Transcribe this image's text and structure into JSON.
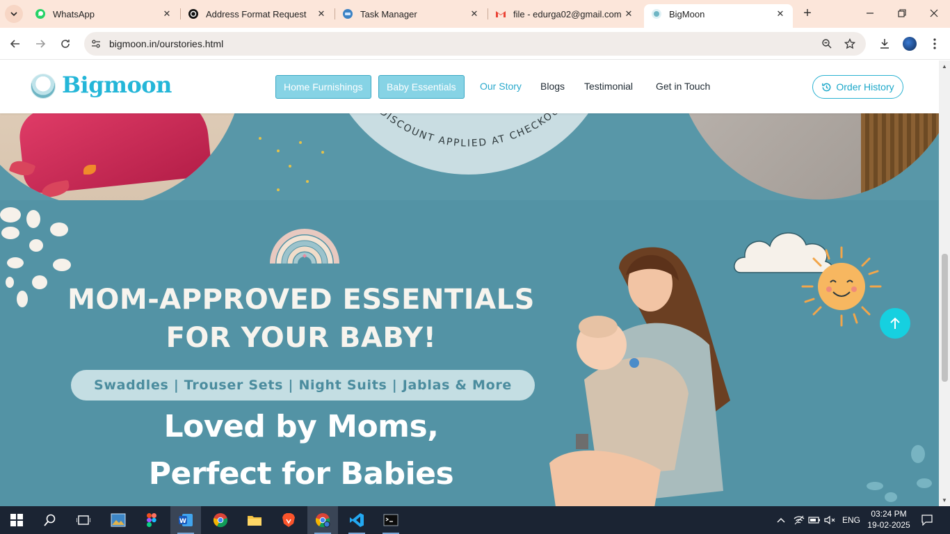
{
  "browser": {
    "tabs": [
      {
        "title": "WhatsApp",
        "icon": "whatsapp-icon",
        "active": false
      },
      {
        "title": "Address Format Request",
        "icon": "openai-icon",
        "active": false
      },
      {
        "title": "Task Manager",
        "icon": "task-manager-icon",
        "active": false
      },
      {
        "title": "file - edurga02@gmail.com",
        "icon": "gmail-icon",
        "active": false
      },
      {
        "title": "BigMoon",
        "icon": "bigmoon-favicon",
        "active": true
      }
    ],
    "url": "bigmoon.in/ourstories.html"
  },
  "site": {
    "logo_text": "Bigmoon",
    "nav": {
      "home_furnishings": "Home Furnishings",
      "baby_essentials": "Baby Essentials",
      "our_story": "Our Story",
      "blogs": "Blogs",
      "testimonial": "Testimonial",
      "get_in_touch": "Get in Touch"
    },
    "order_history": "Order History",
    "accent_color": "#2aa9cc"
  },
  "hero": {
    "discount_text": "• DISCOUNT APPLIED AT CHECKOUT"
  },
  "banner": {
    "headline_line1": "MOM-APPROVED ESSENTIALS",
    "headline_line2": "FOR YOUR BABY!",
    "categories": "Swaddles | Trouser Sets | Night Suits | Jablas & More",
    "tagline_line1": "Loved by Moms,",
    "tagline_line2": "Perfect for Babies",
    "background_color": "#5393a5"
  },
  "taskbar": {
    "apps": [
      "start-icon",
      "search-icon",
      "task-view-icon",
      "photos-icon",
      "figma-icon",
      "word-icon",
      "chrome-icon",
      "file-explorer-icon",
      "brave-icon",
      "chrome-profile-icon",
      "vscode-icon",
      "terminal-icon"
    ],
    "language": "ENG",
    "time": "03:24 PM",
    "date": "19-02-2025"
  }
}
